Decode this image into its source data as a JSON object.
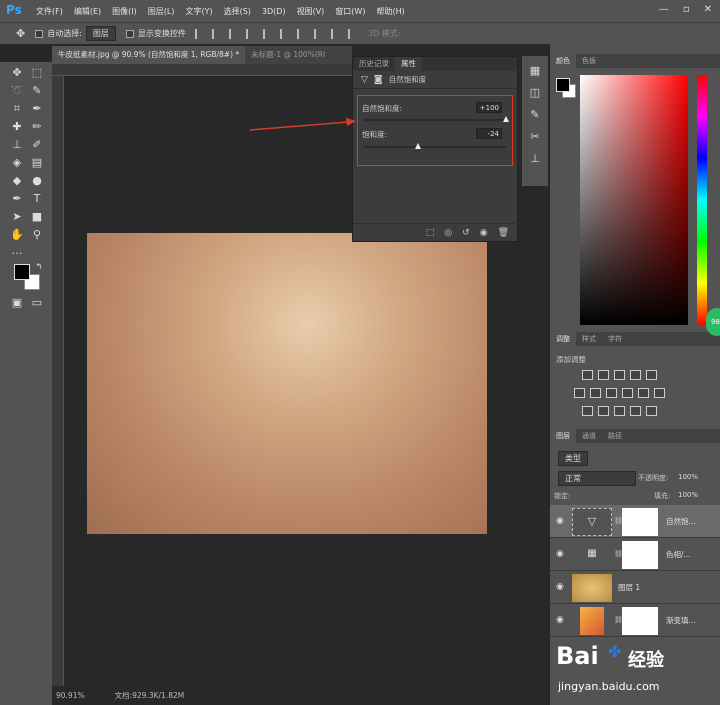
{
  "app": {
    "logo": "Ps"
  },
  "menu": [
    "文件(F)",
    "编辑(E)",
    "图像(I)",
    "图层(L)",
    "文字(Y)",
    "选择(S)",
    "3D(D)",
    "视图(V)",
    "窗口(W)",
    "帮助(H)"
  ],
  "window_controls": [
    "—",
    "▫",
    "✕"
  ],
  "options_bar": {
    "auto_select": "自动选择:",
    "auto_select_value": "图层",
    "show_transform": "显示变换控件",
    "mode_3d": "3D 模式:"
  },
  "tabs": [
    {
      "label": "牛皮纸素材.jpg @ 90.9% (自然饱和度 1, RGB/8#) *",
      "active": true
    },
    {
      "label": "未标题-1 @ 100%(RGB",
      "active": false
    }
  ],
  "properties": {
    "tabs": [
      "历史记录",
      "属性"
    ],
    "title": "自然饱和度",
    "sliders": [
      {
        "label": "自然饱和度:",
        "value": "+100",
        "fraction": 1.0
      },
      {
        "label": "饱和度:",
        "value": "-24",
        "fraction": 0.38
      }
    ],
    "footer_icons": [
      "clip-icon",
      "view-prev-icon",
      "reset-icon",
      "visibility-icon",
      "delete-icon"
    ]
  },
  "statusbar": {
    "zoom": "90.91%",
    "doc": "文档:929.3K/1.82M"
  },
  "color_panel": {
    "tabs": [
      "颜色",
      "色板"
    ],
    "fg_color": "#000000",
    "bg_color": "#ffffff",
    "badge": "98"
  },
  "adjust_panel": {
    "tabs": [
      "调整",
      "样式",
      "字符"
    ],
    "title": "添加调整"
  },
  "layers_panel": {
    "tabs": [
      "图层",
      "通道",
      "路径"
    ],
    "filter_kind": "类型",
    "blend_mode": "正常",
    "opacity_label": "不透明度:",
    "opacity": "100%",
    "lock_label": "锁定:",
    "fill_label": "填充:",
    "fill": "100%",
    "layers": [
      {
        "name": "自然饱...",
        "selected": true
      },
      {
        "name": "色相/...",
        "selected": false
      },
      {
        "name": "图层 1",
        "selected": false
      },
      {
        "name": "渐变填...",
        "selected": false
      }
    ]
  },
  "watermark": {
    "brand": "Bai",
    "brand2": "经验",
    "url": "jingyan.baidu.com"
  }
}
